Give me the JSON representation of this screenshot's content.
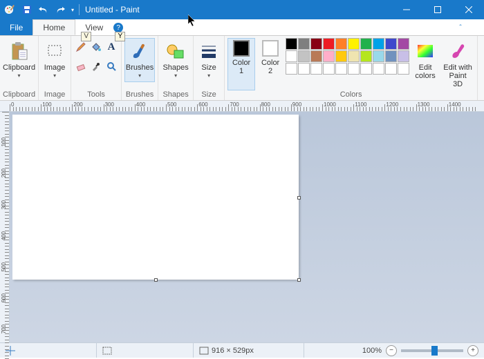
{
  "window": {
    "title": "Untitled - Paint"
  },
  "tabs": {
    "file": "File",
    "home": "Home",
    "view": "View"
  },
  "keytips": {
    "view": "V",
    "help": "Y"
  },
  "ribbon": {
    "clipboard": {
      "label": "Clipboard",
      "button": "Clipboard"
    },
    "image": {
      "label": "Image",
      "button": "Image"
    },
    "tools": {
      "label": "Tools"
    },
    "brushes": {
      "label": "Brushes",
      "button": "Brushes"
    },
    "shapes": {
      "label": "Shapes",
      "button": "Shapes"
    },
    "size": {
      "label": "Size",
      "button": "Size"
    },
    "colors": {
      "label": "Colors",
      "color1": "Color 1",
      "color2": "Color 2",
      "edit": "Edit colors",
      "p3d": "Edit with Paint 3D"
    }
  },
  "colors": {
    "color1": "#000000",
    "color2": "#ffffff",
    "palette": [
      "#000000",
      "#7f7f7f",
      "#880015",
      "#ed1c24",
      "#ff7f27",
      "#fff200",
      "#22b14c",
      "#00a2e8",
      "#3f48cc",
      "#a349a4",
      "#ffffff",
      "#c3c3c3",
      "#b97a57",
      "#ffaec9",
      "#ffc90e",
      "#efe4b0",
      "#b5e61d",
      "#99d9ea",
      "#7092be",
      "#c8bfe7",
      "#ffffff",
      "#ffffff",
      "#ffffff",
      "#ffffff",
      "#ffffff",
      "#ffffff",
      "#ffffff",
      "#ffffff",
      "#ffffff",
      "#ffffff"
    ]
  },
  "ruler": {
    "marks": [
      0,
      100,
      200,
      300,
      400,
      500,
      600,
      700,
      800,
      900,
      1000,
      1100,
      1200,
      1300,
      1400
    ]
  },
  "status": {
    "size": "916 × 529px",
    "zoom": "100%"
  }
}
